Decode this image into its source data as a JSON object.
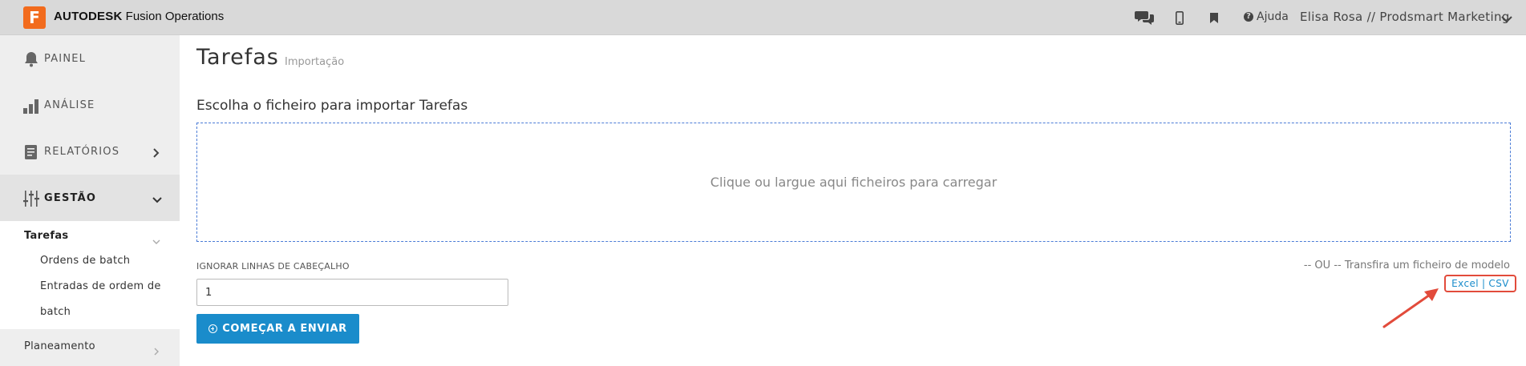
{
  "topbar": {
    "logo_letter": "F",
    "brand_bold": "AUTODESK",
    "brand_product": "Fusion Operations",
    "help_label": "Ajuda",
    "user_label": "Elisa Rosa // Prodsmart Marketing"
  },
  "sidebar": {
    "items": [
      {
        "label": "PAINEL",
        "icon": "bell-icon"
      },
      {
        "label": "ANÁLISE",
        "icon": "bar-chart-icon"
      },
      {
        "label": "RELATÓRIOS",
        "icon": "document-icon"
      },
      {
        "label": "GESTÃO",
        "icon": "sliders-icon"
      }
    ],
    "sub": {
      "tarefas": "Tarefas",
      "children": [
        "Ordens de batch",
        "Entradas de ordem de",
        "batch"
      ]
    },
    "planeamento": "Planeamento"
  },
  "main": {
    "title": "Tarefas",
    "subtitle": "Importação",
    "section_title": "Escolha o ficheiro para importar Tarefas",
    "dropzone_text": "Clique ou largue aqui ficheiros para carregar",
    "ignore_label": "IGNORAR LINHAS DE CABEÇALHO",
    "ignore_value": "1",
    "start_button": "COMEÇAR A ENVIAR",
    "template_text": "-- OU -- Transfira um ficheiro de modelo",
    "excel_link": "Excel",
    "csv_link": "CSV",
    "link_separator": "|"
  },
  "colors": {
    "accent": "#1a8ccb",
    "logo": "#f26b1d",
    "highlight": "#e24b3b",
    "dropzone_border": "#4a7bd6"
  }
}
